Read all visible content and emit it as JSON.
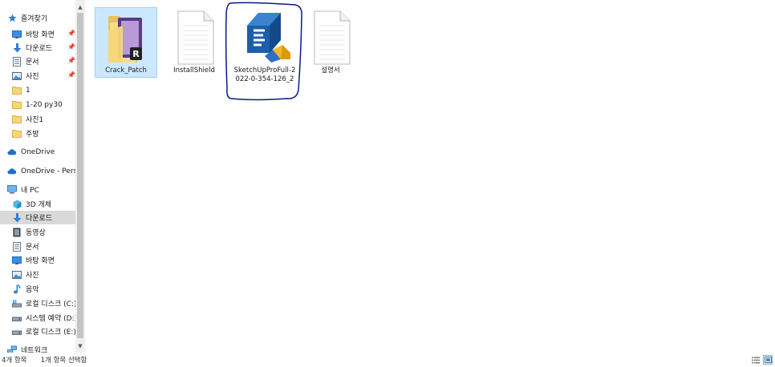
{
  "sidebar": {
    "quick_access": {
      "label": "즐겨찾기",
      "icon": "star-icon"
    },
    "quick_items": [
      {
        "label": "바탕 화면",
        "icon": "desktop-icon",
        "pinned": true
      },
      {
        "label": "다운로드",
        "icon": "download-arrow-icon",
        "pinned": true
      },
      {
        "label": "문서",
        "icon": "document-icon",
        "pinned": true
      },
      {
        "label": "사진",
        "icon": "pictures-icon",
        "pinned": true
      },
      {
        "label": "1",
        "icon": "folder-icon",
        "pinned": false
      },
      {
        "label": "1-20 py30",
        "icon": "folder-icon",
        "pinned": false
      },
      {
        "label": "사진1",
        "icon": "folder-icon",
        "pinned": false
      },
      {
        "label": "주방",
        "icon": "folder-icon",
        "pinned": false
      }
    ],
    "onedrive": {
      "label": "OneDrive",
      "icon": "cloud-icon"
    },
    "onedrive_personal": {
      "label": "OneDrive - Persor",
      "icon": "cloud-icon"
    },
    "this_pc": {
      "label": "내 PC",
      "icon": "computer-icon"
    },
    "pc_items": [
      {
        "label": "3D 개체",
        "icon": "cube-3d-icon"
      },
      {
        "label": "다운로드",
        "icon": "download-arrow-icon",
        "selected": true
      },
      {
        "label": "동영상",
        "icon": "video-icon"
      },
      {
        "label": "문서",
        "icon": "document-icon"
      },
      {
        "label": "바탕 화면",
        "icon": "desktop-icon"
      },
      {
        "label": "사진",
        "icon": "pictures-icon"
      },
      {
        "label": "음악",
        "icon": "music-note-icon"
      },
      {
        "label": "로컬 디스크 (C:)",
        "icon": "system-drive-icon"
      },
      {
        "label": "시스템 예약 (D:)",
        "icon": "drive-icon"
      },
      {
        "label": "로컬 디스크 (E:)",
        "icon": "drive-icon"
      }
    ],
    "network": {
      "label": "네트워크",
      "icon": "network-icon"
    }
  },
  "files": [
    {
      "name": "Crack_Patch",
      "type": "folder",
      "icon": "folder-winrar-icon",
      "selected": true
    },
    {
      "name": "InstallShield",
      "type": "file",
      "icon": "blank-file-icon",
      "selected": false
    },
    {
      "name": "SketchUpProFull-2022-0-354-126_2",
      "type": "exe",
      "icon": "sketchup-installer-icon",
      "selected": false,
      "annotated": true
    },
    {
      "name": "설명서",
      "type": "file",
      "icon": "blank-file-icon",
      "selected": false
    }
  ],
  "status": {
    "item_count": "4개 항목",
    "selection": "1개 항목 선택함"
  },
  "view_buttons": [
    {
      "icon": "details-view-icon",
      "active": false
    },
    {
      "icon": "large-icons-view-icon",
      "active": true
    }
  ],
  "colors": {
    "selection_bg": "#cce8ff",
    "selection_border": "#99d1ff",
    "nav_selected": "#d9d9d9",
    "annotation_ink": "#0a1a8c",
    "sketchup_blue": "#1d5ea8",
    "folder_yellow": "#f5d77a"
  }
}
